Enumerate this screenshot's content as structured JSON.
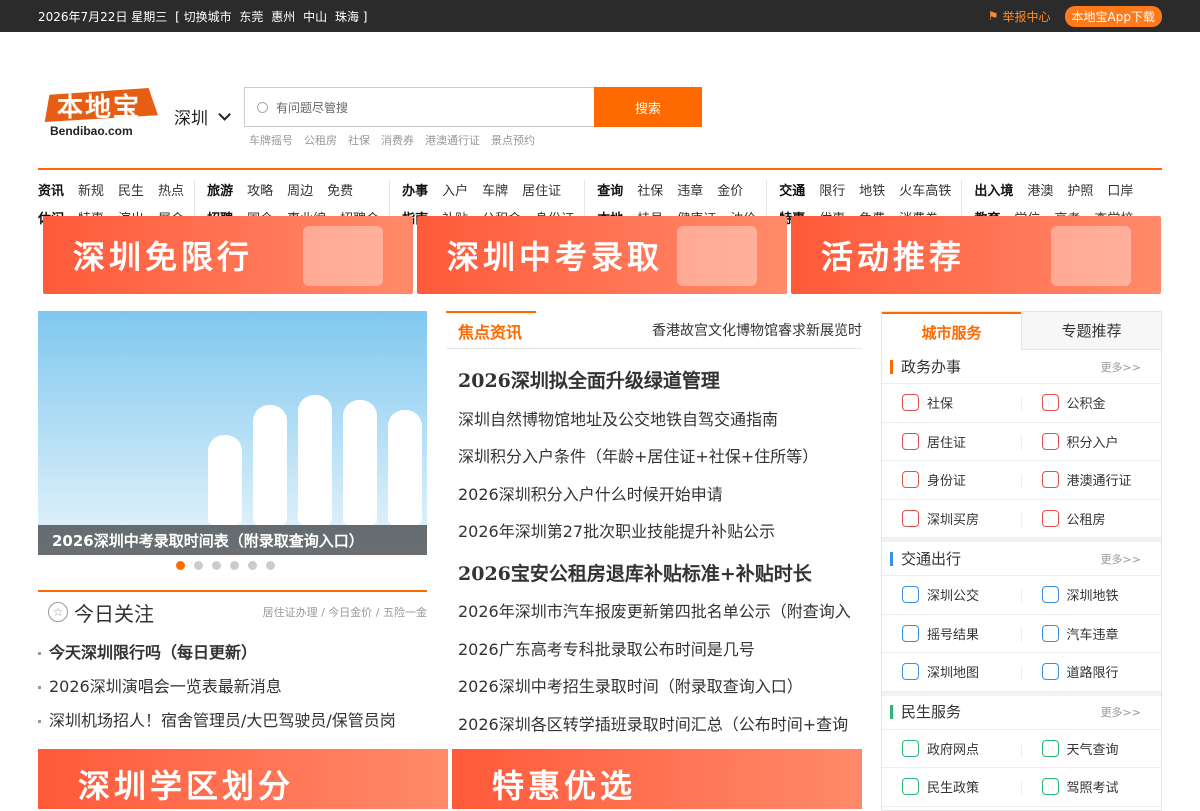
{
  "topbar": {
    "date": "2026年7月22日 星期三",
    "switch_label": "[ 切换城市",
    "cities": [
      "东莞",
      "惠州",
      "中山",
      "珠海 ]"
    ],
    "report": "举报中心",
    "app": "本地宝App下载"
  },
  "logo": {
    "cn": "本地宝",
    "en": "Bendibao.com"
  },
  "city": {
    "name": "深圳"
  },
  "search": {
    "placeholder": "有问题尽管搜",
    "button": "搜索"
  },
  "hot_keywords": [
    "车牌摇号",
    "公租房",
    "社保",
    "消费券",
    "港澳通行证",
    "景点预约"
  ],
  "nav": [
    {
      "rows": [
        [
          "资讯",
          "新规",
          "民生",
          "热点"
        ],
        [
          "休闲",
          "特惠",
          "演出",
          "展会"
        ]
      ]
    },
    {
      "rows": [
        [
          "旅游",
          "攻略",
          "周边",
          "免费"
        ],
        [
          "招聘",
          "国企",
          "事业编",
          "招聘会"
        ]
      ]
    },
    {
      "rows": [
        [
          "办事",
          "入户",
          "车牌",
          "居住证"
        ],
        [
          "指南",
          "补贴",
          "公积金",
          "身份证"
        ]
      ]
    },
    {
      "rows": [
        [
          "查询",
          "社保",
          "违章",
          "金价"
        ],
        [
          "本地",
          "挂号",
          "健康证",
          "油价"
        ]
      ]
    },
    {
      "rows": [
        [
          "交通",
          "限行",
          "地铁",
          "火车高铁"
        ],
        [
          "特惠",
          "优惠",
          "免费",
          "消费券"
        ]
      ]
    },
    {
      "rows": [
        [
          "出入境",
          "港澳",
          "护照",
          "口岸"
        ],
        [
          "教育",
          "学位",
          "高考",
          "查学校"
        ]
      ]
    }
  ],
  "banners": [
    "深圳免限行",
    "深圳中考录取",
    "活动推荐"
  ],
  "slider": {
    "caption": "2026深圳中考录取时间表（附录取查询入口）",
    "dots": 6,
    "active": 1
  },
  "today": {
    "title": "今日关注",
    "links": "居住证办理 / 今日金价 / 五险一金",
    "items": [
      {
        "text": "今天深圳限行吗（每日更新）",
        "bold": true
      },
      {
        "text": "2026深圳演唱会一览表最新消息",
        "bold": false
      },
      {
        "text": "深圳机场招人！宿舍管理员/大巴驾驶员/保管员岗",
        "bold": false
      }
    ]
  },
  "bottom_banners": [
    "深圳学区划分",
    "特惠优选"
  ],
  "focus": {
    "tab": "焦点资讯",
    "marquee": "香港故宫文化博物馆睿求新展览时",
    "items": [
      {
        "text": "2026深圳拟全面升级绿道管理",
        "big": true
      },
      {
        "text": "深圳自然博物馆地址及公交地铁自驾交通指南",
        "big": false
      },
      {
        "text": "深圳积分入户条件（年龄+居住证+社保+住所等）",
        "big": false
      },
      {
        "text": "2026深圳积分入户什么时候开始申请",
        "big": false
      },
      {
        "text": "2026年深圳第27批次职业技能提升补贴公示",
        "big": false
      },
      {
        "text": "2026宝安公租房退库补贴标准+补贴时长",
        "big": true
      },
      {
        "text": "2026年深圳市汽车报废更新第四批名单公示（附查询入",
        "big": false
      },
      {
        "text": "2026广东高考专科批录取公布时间是几号",
        "big": false
      },
      {
        "text": "2026深圳中考招生录取时间（附录取查询入口）",
        "big": false
      },
      {
        "text": "2026深圳各区转学插班录取时间汇总（公布时间+查询",
        "big": false
      }
    ]
  },
  "sidebar": {
    "tabs": [
      "城市服务",
      "专题推荐"
    ],
    "sections": [
      {
        "title": "政务办事",
        "more": "更多>>",
        "color": "red",
        "items": [
          [
            "社保",
            "r"
          ],
          [
            "公积金",
            "r"
          ],
          [
            "居住证",
            "r"
          ],
          [
            "积分入户",
            "r"
          ],
          [
            "身份证",
            "r"
          ],
          [
            "港澳通行证",
            "r"
          ],
          [
            "深圳买房",
            "r"
          ],
          [
            "公租房",
            "r"
          ]
        ]
      },
      {
        "title": "交通出行",
        "more": "更多>>",
        "color": "blue",
        "items": [
          [
            "深圳公交",
            "b"
          ],
          [
            "深圳地铁",
            "b"
          ],
          [
            "摇号结果",
            "b"
          ],
          [
            "汽车违章",
            "b"
          ],
          [
            "深圳地图",
            "b"
          ],
          [
            "道路限行",
            "b"
          ]
        ]
      },
      {
        "title": "民生服务",
        "more": "更多>>",
        "color": "green",
        "items": [
          [
            "政府网点",
            "g"
          ],
          [
            "天气查询",
            "g"
          ],
          [
            "民生政策",
            "g"
          ],
          [
            "驾照考试",
            "g"
          ]
        ]
      }
    ]
  }
}
